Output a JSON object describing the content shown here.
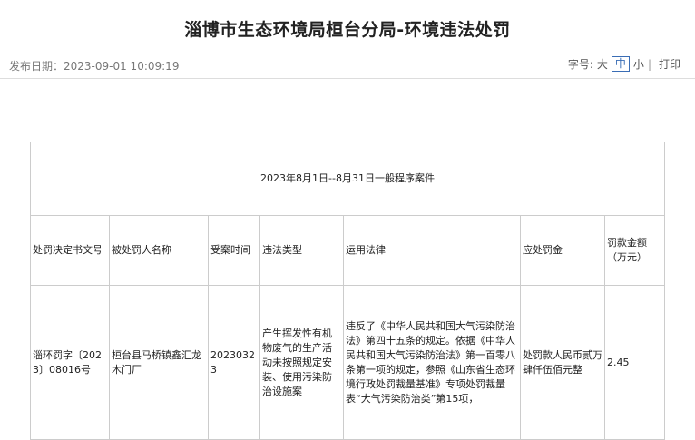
{
  "page": {
    "title": "淄博市生态环境局桓台分局-环境违法处罚",
    "publish_date": "发布日期：2023-09-01 10:09:19",
    "font_size_label": "字号:",
    "font_large": "大",
    "font_medium": "中",
    "font_small": "小",
    "separator": "|",
    "print_label": "打印"
  },
  "table": {
    "caption": "2023年8月1日--8月31日一般程序案件",
    "headers": [
      "处罚决定书文号",
      "被处罚人名称",
      "受案时间",
      "违法类型",
      "运用法律",
      "应处罚金",
      "罚款金额（万元）"
    ],
    "rows": [
      {
        "doc_no": "淄环罚字〔2023〕08016号",
        "party": "桓台县马桥镇鑫汇龙木门厂",
        "date": "20230323",
        "type": "产生挥发性有机物废气的生产活动未按照规定安装、使用污染防治设施案",
        "law": "违反了《中华人民共和国大气污染防治法》第四十五条的规定。依据《中华人民共和国大气污染防治法》第一百零八条第一项的规定，参照《山东省生态环境行政处罚裁量基准》专项处罚裁量表“大气污染防治类”第15项，",
        "penalty": "处罚款人民币贰万肆仟伍佰元整",
        "amount": "2.45"
      }
    ]
  }
}
